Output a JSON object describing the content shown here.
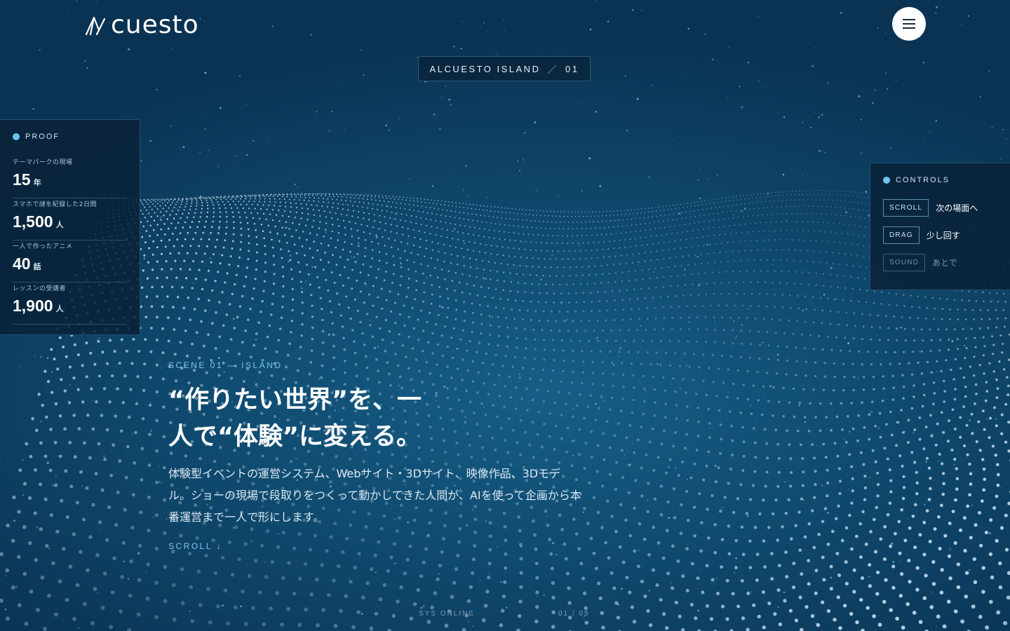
{
  "brand": {
    "logo_text": "cuesto"
  },
  "header": {
    "menu_icon": "hamburger-icon",
    "badge_main": "ALCUESTO ISLAND",
    "badge_sep": "／",
    "badge_number": "01"
  },
  "proof": {
    "title": "PROOF",
    "stats": [
      {
        "label": "テーマパークの現場",
        "value": "15",
        "unit": "年"
      },
      {
        "label": "スマホで謎を紀録した2日間",
        "value": "1,500",
        "unit": "人"
      },
      {
        "label": "一人で作ったアニメ",
        "value": "40",
        "unit": "話"
      },
      {
        "label": "レッスンの受講者",
        "value": "1,900",
        "unit": "人"
      }
    ]
  },
  "controls": {
    "title": "CONTROLS",
    "items": [
      {
        "key": "SCROLL",
        "desc": "次の場面へ"
      },
      {
        "key": "DRAG",
        "desc": "少し回す"
      },
      {
        "key": "SOUND",
        "desc": "あとで"
      }
    ]
  },
  "hero": {
    "scene_label": "SCENE 01 — ISLAND",
    "headline_line1": "“作りたい世界”を、一",
    "headline_line2": "人で“体験”に変える。",
    "lead": "体験型イベントの運営システム、Webサイト・3Dサイト、映像作品、3Dモデル。ショーの現場で段取りをつくって動かしてきた人間が、AIを使って企画から本番運営まで一人で形にします。",
    "scroll_label": "SCROLL ↓"
  },
  "footer": {
    "status": "SYS ONLINE",
    "page_count": "01 / 05"
  },
  "colors": {
    "background": "#0f4a6f",
    "accent": "#6ec3ef",
    "panel": "#092238"
  }
}
